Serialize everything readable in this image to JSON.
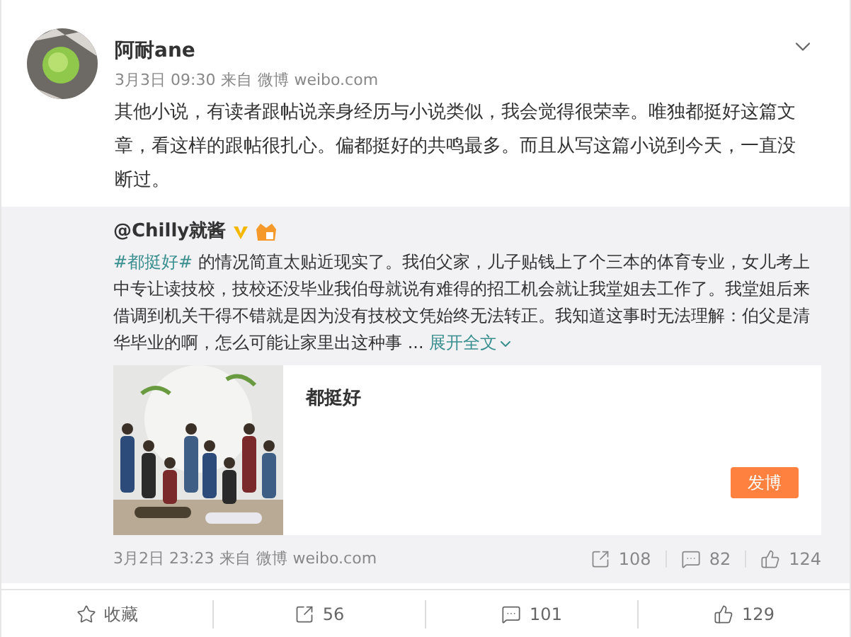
{
  "post": {
    "author": "阿耐ane",
    "time": "3月3日 09:30",
    "source_prefix": "来自",
    "source": "微博 weibo.com",
    "text": "其他小说，有读者跟帖说亲身经历与小说类似，我会觉得很荣幸。唯独都挺好这篇文章，看这样的跟帖很扎心。偏都挺好的共鸣最多。而且从写这篇小说到今天，一直没断过。"
  },
  "repost": {
    "author": "@Chilly就酱",
    "hashtag": "#都挺好#",
    "text": " 的情况简直太贴近现实了。我伯父家，儿子贴钱上了个三本的体育专业，女儿考上中专让读技校，技校还没毕业我伯母就说有难得的招工机会就让我堂姐去工作了。我堂姐后来借调到机关干得不错就是因为没有技校文凭始终无法转正。我知道这事时无法理解：伯父是清华毕业的啊，怎么可能让家里出这种事 ...",
    "expand": "展开全文",
    "card": {
      "title": "都挺好",
      "button": "发博"
    },
    "time": "3月2日 23:23",
    "source_prefix": "来自",
    "source": "微博 weibo.com",
    "stats": [
      {
        "kind": "repost",
        "count": "108"
      },
      {
        "kind": "comment",
        "count": "82"
      },
      {
        "kind": "like",
        "count": "124"
      }
    ]
  },
  "actions": [
    {
      "kind": "favorite",
      "label": "收藏"
    },
    {
      "kind": "repost",
      "label": "56"
    },
    {
      "kind": "comment",
      "label": "101"
    },
    {
      "kind": "like",
      "label": "129"
    }
  ]
}
